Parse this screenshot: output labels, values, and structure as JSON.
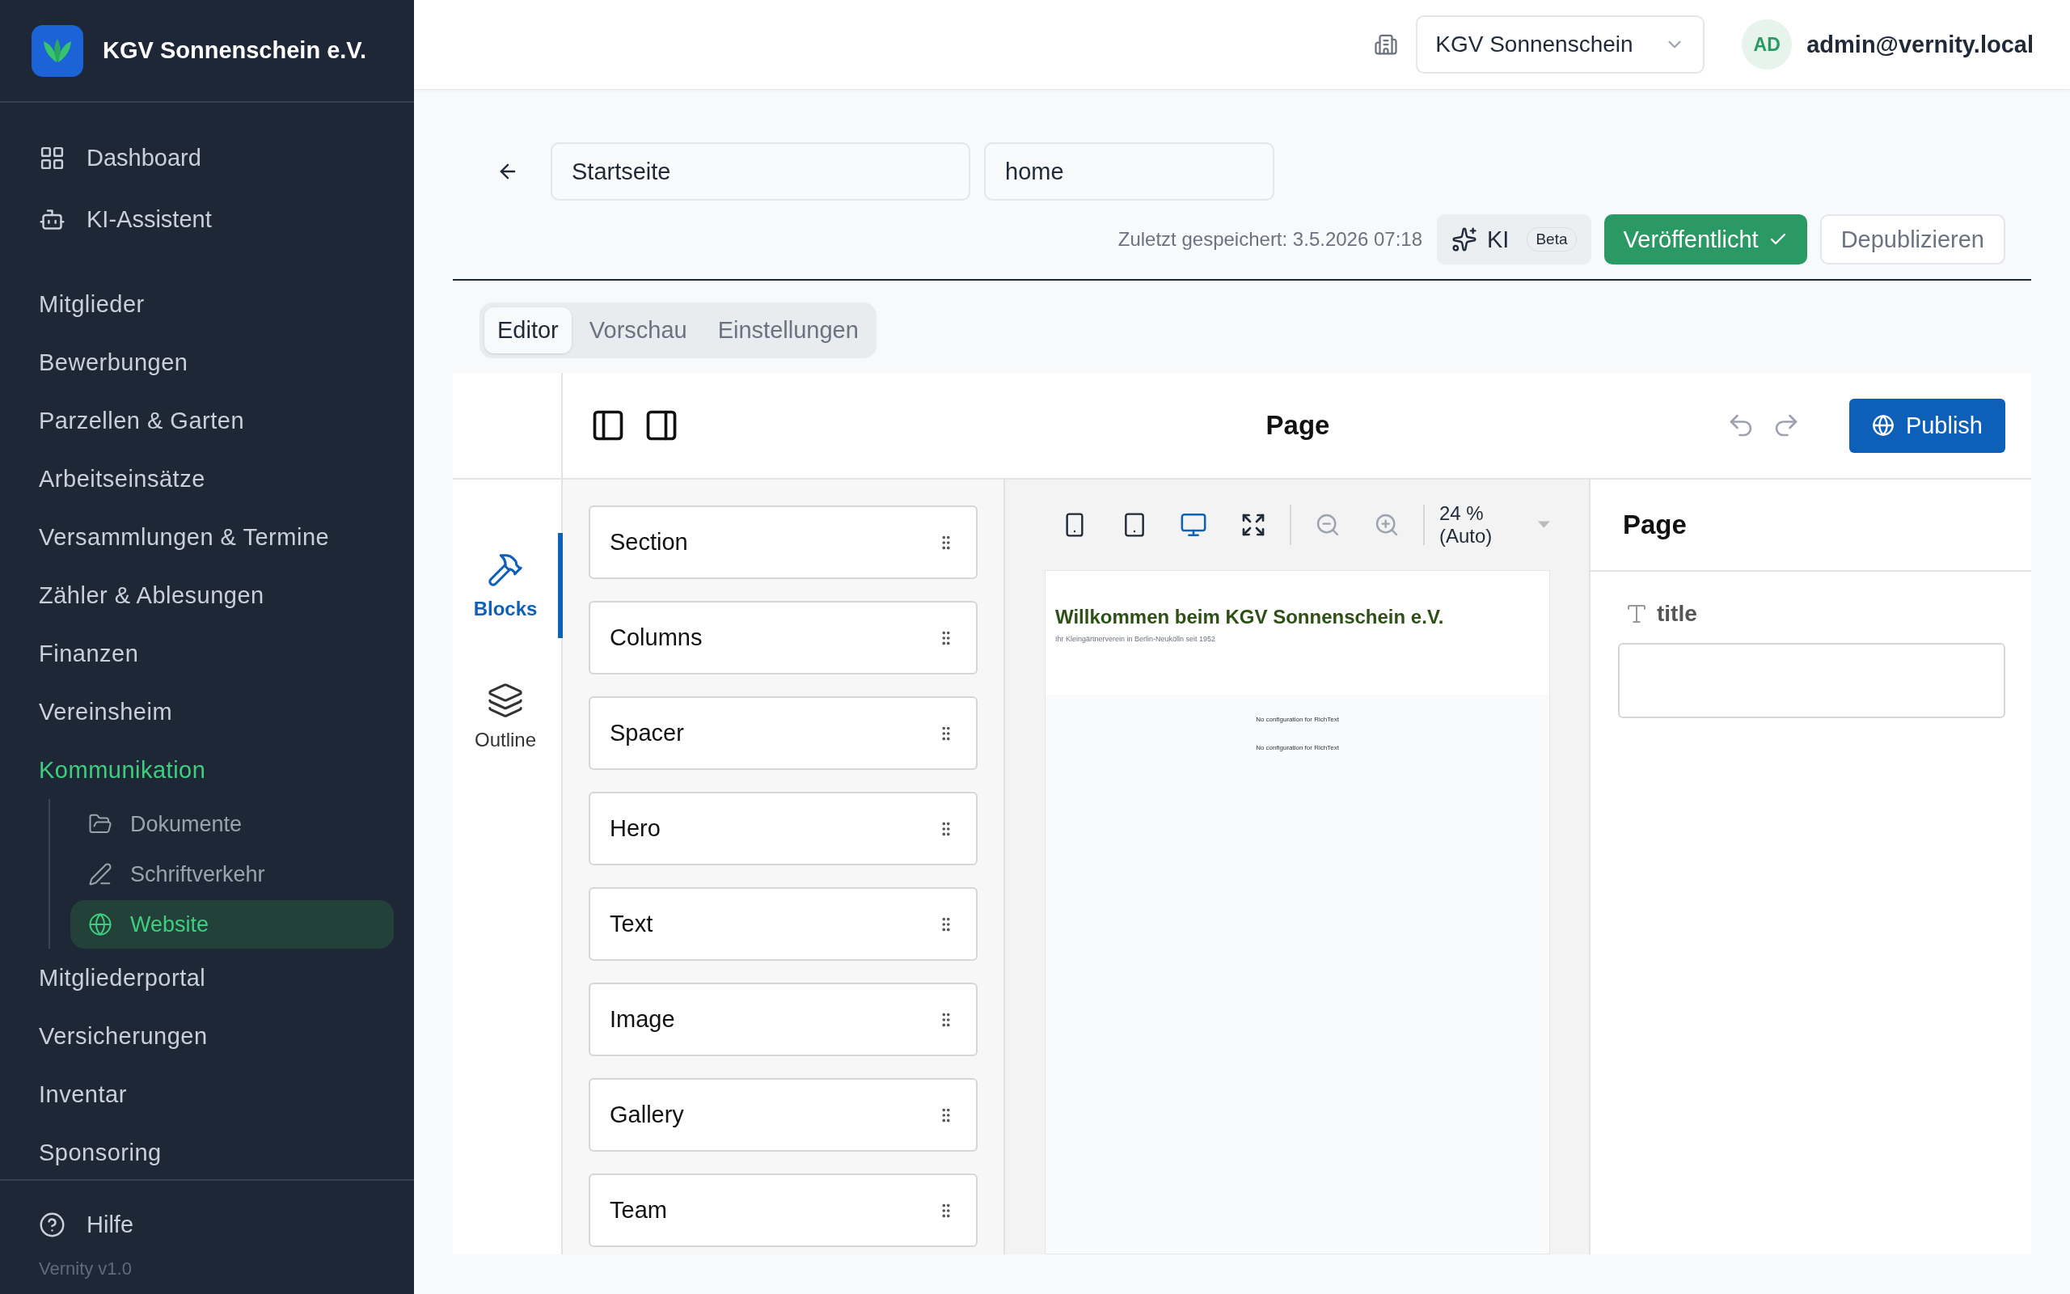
{
  "sidebar": {
    "brand": "KGV Sonnenschein e.V.",
    "top_links": [
      {
        "label": "Dashboard",
        "selected": false
      },
      {
        "label": "KI-Assistent",
        "selected": false
      }
    ],
    "groups": [
      {
        "label": "Mitglieder",
        "expanded": false
      },
      {
        "label": "Bewerbungen",
        "expanded": false
      },
      {
        "label": "Parzellen & Garten",
        "expanded": false
      },
      {
        "label": "Arbeitseinsätze",
        "expanded": false
      },
      {
        "label": "Versammlungen & Termine",
        "expanded": false
      },
      {
        "label": "Zähler & Ablesungen",
        "expanded": false
      },
      {
        "label": "Finanzen",
        "expanded": false
      },
      {
        "label": "Vereinsheim",
        "expanded": false
      },
      {
        "label": "Kommunikation",
        "expanded": true,
        "children": [
          {
            "label": "Dokumente",
            "selected": false
          },
          {
            "label": "Schriftverkehr",
            "selected": false
          },
          {
            "label": "Website",
            "selected": true
          }
        ]
      },
      {
        "label": "Mitgliederportal",
        "expanded": false
      },
      {
        "label": "Versicherungen",
        "expanded": false
      },
      {
        "label": "Inventar",
        "expanded": false
      },
      {
        "label": "Sponsoring",
        "expanded": false
      }
    ],
    "help": "Hilfe",
    "version": "Vernity v1.0"
  },
  "topbar": {
    "organization": "KGV Sonnenschein",
    "avatar": "AD",
    "user": "admin@vernity.local"
  },
  "page_header": {
    "title": "Startseite",
    "slug": "home",
    "saved": "Zuletzt gespeichert: 3.5.2026 07:18",
    "ai_button": "KI",
    "ai_badge": "Beta",
    "status": "Veröffentlicht",
    "unpublish": "Depublizieren"
  },
  "tabs": [
    {
      "label": "Editor",
      "selected": true
    },
    {
      "label": "Vorschau",
      "selected": false
    },
    {
      "label": "Einstellungen",
      "selected": false
    }
  ],
  "editor": {
    "title": "Page",
    "publish": "Publish",
    "rail": [
      {
        "label": "Blocks",
        "selected": true
      },
      {
        "label": "Outline",
        "selected": false
      }
    ],
    "blocks": [
      "Section",
      "Columns",
      "Spacer",
      "Hero",
      "Text",
      "Image",
      "Gallery",
      "Team"
    ],
    "devices": [
      {
        "kind": "phone",
        "selected": false
      },
      {
        "kind": "tablet",
        "selected": false
      },
      {
        "kind": "desktop",
        "selected": true
      }
    ],
    "zoom": "24 % (Auto)",
    "preview": {
      "heading": "Willkommen beim KGV Sonnenschein e.V.",
      "subtitle": "Ihr Kleingärtnerverein in Berlin-Neukölln seit 1952",
      "notes": [
        "No configuration for RichText",
        "No configuration for RichText"
      ]
    },
    "fields_panel": {
      "title": "Page",
      "fields": [
        {
          "label": "title"
        }
      ]
    }
  }
}
